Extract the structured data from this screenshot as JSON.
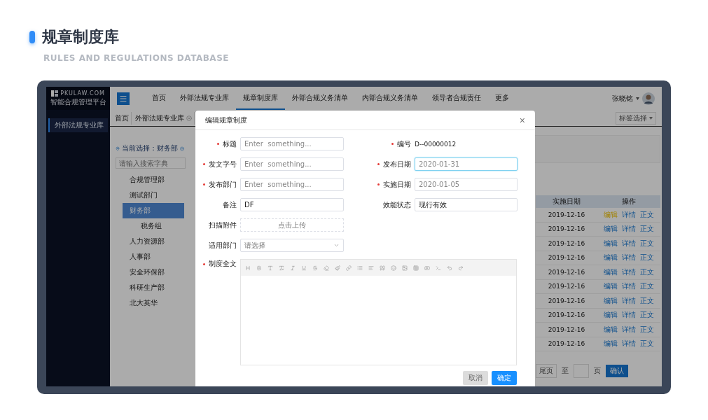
{
  "header": {
    "title": "规章制度库",
    "subtitle": "RULES AND REGULATIONS DATABASE"
  },
  "logo": {
    "site": "PKULAW.COM",
    "tagline": "智能合规管理平台"
  },
  "sidebar": {
    "items": [
      {
        "label": "外部法规专业库",
        "selected": true
      }
    ]
  },
  "nav": {
    "items": [
      {
        "label": "首页",
        "selected": false
      },
      {
        "label": "外部法规专业库",
        "selected": false
      },
      {
        "label": "规章制度库",
        "selected": true
      },
      {
        "label": "外部合规义务清单",
        "selected": false
      },
      {
        "label": "内部合规义务清单",
        "selected": false
      },
      {
        "label": "领导者合规责任",
        "selected": false
      },
      {
        "label": "更多",
        "selected": false
      }
    ]
  },
  "user": {
    "name": "张晓铭"
  },
  "breadcrumb": {
    "tabs": [
      {
        "label": "首页",
        "closable": false
      },
      {
        "label": "外部法规专业库",
        "closable": true
      }
    ],
    "tag_select": "标签选择"
  },
  "tree": {
    "current": "当前选择：财务部",
    "search_placeholder": "请输入搜索字典",
    "items": [
      {
        "label": "合规管理部",
        "selected": false
      },
      {
        "label": "测试部门",
        "selected": false
      },
      {
        "label": "财务部",
        "selected": true,
        "children": [
          {
            "label": "税务组",
            "selected": false
          }
        ]
      },
      {
        "label": "人力资源部",
        "selected": false
      },
      {
        "label": "人事部",
        "selected": false
      },
      {
        "label": "安全环保部",
        "selected": false
      },
      {
        "label": "科研生产部",
        "selected": false
      },
      {
        "label": "北大英华",
        "selected": false
      }
    ]
  },
  "table": {
    "columns": [
      "实施日期",
      "操作"
    ],
    "rows": [
      {
        "date": "2019-12-16",
        "actions": [
          {
            "label": "编辑",
            "highlighted": true
          },
          {
            "label": "详情",
            "highlighted": false
          },
          {
            "label": "正文",
            "highlighted": false
          }
        ]
      },
      {
        "date": "2019-12-16",
        "actions": [
          {
            "label": "编辑",
            "highlighted": false
          },
          {
            "label": "详情",
            "highlighted": false
          },
          {
            "label": "正文",
            "highlighted": false
          }
        ]
      },
      {
        "date": "2019-12-16",
        "actions": [
          {
            "label": "编辑",
            "highlighted": false
          },
          {
            "label": "详情",
            "highlighted": false
          },
          {
            "label": "正文",
            "highlighted": false
          }
        ]
      },
      {
        "date": "2019-12-16",
        "actions": [
          {
            "label": "编辑",
            "highlighted": false
          },
          {
            "label": "详情",
            "highlighted": false
          },
          {
            "label": "正文",
            "highlighted": false
          }
        ]
      },
      {
        "date": "2019-12-16",
        "actions": [
          {
            "label": "编辑",
            "highlighted": false
          },
          {
            "label": "详情",
            "highlighted": false
          },
          {
            "label": "正文",
            "highlighted": false
          }
        ]
      },
      {
        "date": "2019-12-16",
        "actions": [
          {
            "label": "编辑",
            "highlighted": false
          },
          {
            "label": "详情",
            "highlighted": false
          },
          {
            "label": "正文",
            "highlighted": false
          }
        ]
      },
      {
        "date": "2019-12-16",
        "actions": [
          {
            "label": "编辑",
            "highlighted": false
          },
          {
            "label": "详情",
            "highlighted": false
          },
          {
            "label": "正文",
            "highlighted": false
          }
        ]
      },
      {
        "date": "2019-12-16",
        "actions": [
          {
            "label": "编辑",
            "highlighted": false
          },
          {
            "label": "详情",
            "highlighted": false
          },
          {
            "label": "正文",
            "highlighted": false
          }
        ]
      },
      {
        "date": "2019-12-16",
        "actions": [
          {
            "label": "编辑",
            "highlighted": false
          },
          {
            "label": "详情",
            "highlighted": false
          },
          {
            "label": "正文",
            "highlighted": false
          }
        ]
      },
      {
        "date": "2019-12-16",
        "actions": [
          {
            "label": "编辑",
            "highlighted": false
          },
          {
            "label": "详情",
            "highlighted": false
          },
          {
            "label": "正文",
            "highlighted": false
          }
        ]
      }
    ]
  },
  "pagination": {
    "last": "尾页",
    "to": "至",
    "page": "页",
    "confirm": "确认"
  },
  "modal": {
    "title": "编辑规章制度",
    "close": "×",
    "rows": [
      [
        {
          "label": "标题",
          "required": true,
          "kind": "input",
          "placeholder": "Enter  something...",
          "focused": false
        },
        {
          "label": "编号",
          "required": true,
          "kind": "text",
          "value": "D--00000012"
        }
      ],
      [
        {
          "label": "发文字号",
          "required": true,
          "kind": "input",
          "placeholder": "Enter  something...",
          "focused": false
        },
        {
          "label": "发布日期",
          "required": true,
          "kind": "input",
          "placeholder": "2020-01-31",
          "focused": true
        }
      ],
      [
        {
          "label": "发布部门",
          "required": true,
          "kind": "input",
          "placeholder": "Enter  something...",
          "focused": false
        },
        {
          "label": "实施日期",
          "required": true,
          "kind": "input",
          "placeholder": "2020-01-05",
          "focused": false
        }
      ],
      [
        {
          "label": "备注",
          "required": false,
          "kind": "input",
          "value": "DF",
          "focused": false
        },
        {
          "label": "效能状态",
          "required": false,
          "kind": "input",
          "value": "现行有效",
          "focused": false
        }
      ],
      [
        {
          "label": "扫描附件",
          "required": false,
          "kind": "upload",
          "value": "点击上传"
        }
      ],
      [
        {
          "label": "适用部门",
          "required": false,
          "kind": "select",
          "placeholder": "请选择"
        }
      ],
      [
        {
          "label": "制度全文",
          "required": true,
          "kind": "editor"
        }
      ]
    ],
    "buttons": [
      {
        "label": "取消",
        "kind": "default",
        "disabled": true
      },
      {
        "label": "确定",
        "kind": "primary",
        "disabled": false
      }
    ]
  }
}
